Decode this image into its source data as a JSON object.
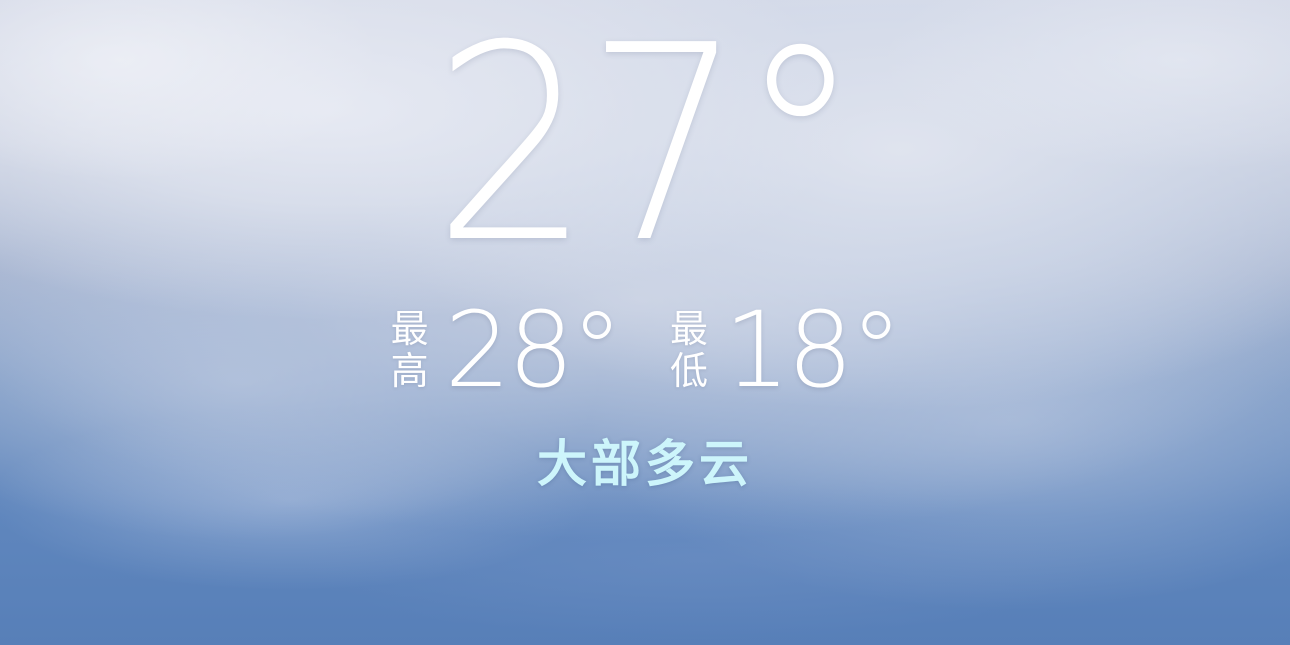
{
  "weather": {
    "current_temp": "27°",
    "high": {
      "label_top": "最",
      "label_bottom": "高",
      "value": "28°"
    },
    "low": {
      "label_top": "最",
      "label_bottom": "低",
      "value": "18°"
    },
    "condition": "大部多云",
    "condition_color": "#cdf5fb"
  }
}
